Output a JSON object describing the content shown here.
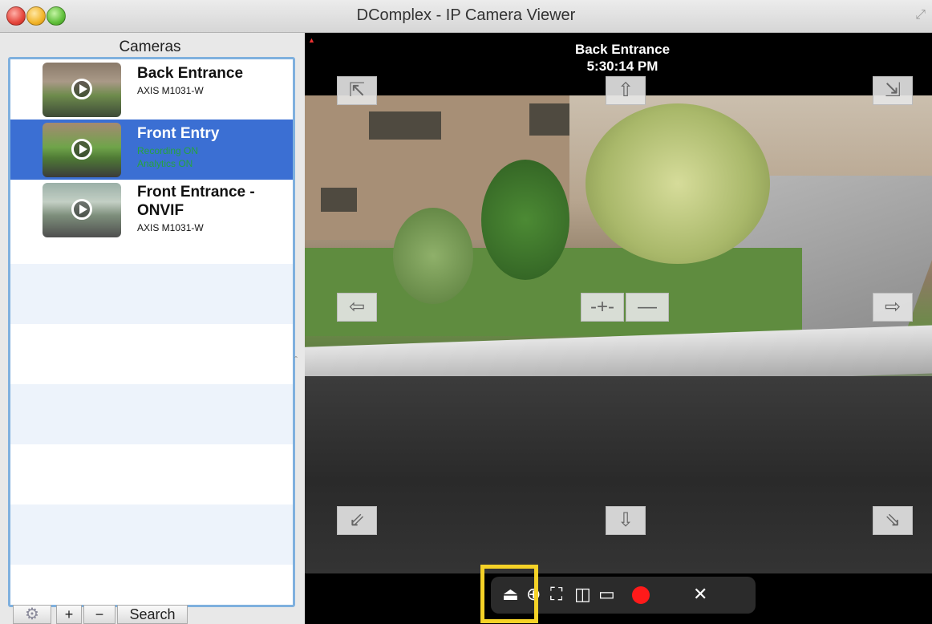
{
  "window": {
    "title": "DComplex - IP Camera Viewer"
  },
  "sidebar": {
    "header": "Cameras",
    "cameras": [
      {
        "name": "Back Entrance",
        "model": "AXIS M1031-W",
        "status": []
      },
      {
        "name": "Front Entry",
        "model": "",
        "status": [
          "Recording ON",
          "Analytics ON"
        ]
      },
      {
        "name_line1": "Front Entrance -",
        "name_line2": "ONVIF",
        "model": "AXIS M1031-W",
        "status": []
      }
    ],
    "toolbar": {
      "settings_icon": "gear-icon",
      "add_label": "+",
      "remove_label": "−",
      "search_label": "Search"
    }
  },
  "video": {
    "camera_name": "Back Entrance",
    "timestamp": "5:30:14 PM",
    "ptz_labels": {
      "up_left": "⇱",
      "up": "⇧",
      "up_right": "⇲",
      "left": "⇦",
      "zoom_in": "-+-",
      "zoom_out": "—",
      "right": "⇨",
      "down_left": "⇙",
      "down": "⇩",
      "down_right": "⇘"
    },
    "controls": {
      "eject_label": "⏏",
      "zoom_label": "⊕",
      "fullscreen_label": "⛶",
      "snapshot_label": "◫",
      "record_mode_label": "▭",
      "close_label": "✕"
    }
  },
  "colors": {
    "selection": "#3b6fd3",
    "status_green": "#26a33f",
    "record_red": "#ff1a1a",
    "highlight": "#f5d227"
  }
}
